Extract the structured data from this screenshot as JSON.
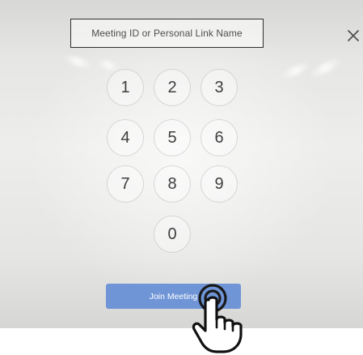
{
  "meeting_join": {
    "input": {
      "placeholder": "Meeting ID or Personal Link Name"
    },
    "keypad": {
      "keys": [
        "1",
        "2",
        "3",
        "4",
        "5",
        "6",
        "7",
        "8",
        "9",
        "0"
      ]
    },
    "join_button_label": "Join Meeting",
    "icons": {
      "close": "close-icon",
      "cursor": "hand-pointer-icon"
    }
  },
  "colors": {
    "accent": "#6f95d7",
    "text": "#3e3e3e",
    "border": "#2f2f2f"
  }
}
